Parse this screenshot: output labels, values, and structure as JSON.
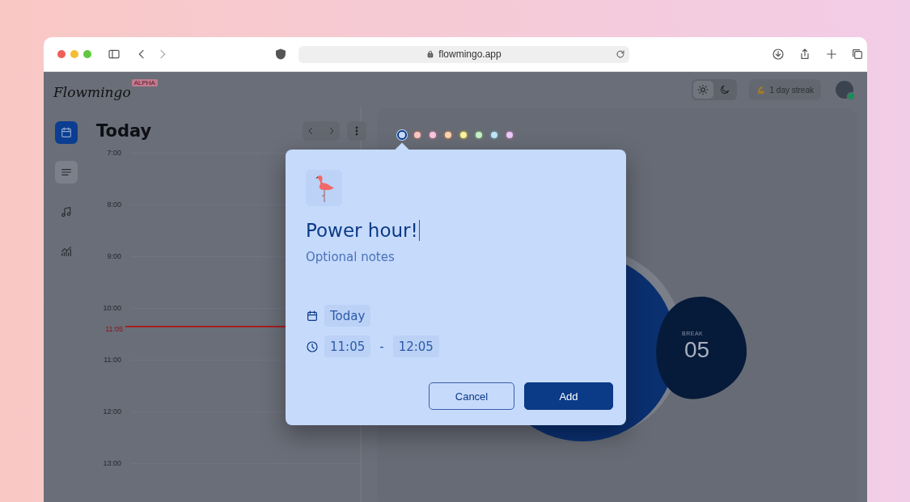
{
  "browser": {
    "url": "flowmingo.app"
  },
  "header": {
    "logo": "Flowmingo",
    "badge": "ALPHA",
    "theme_options": [
      {
        "kind": "light",
        "selected": true
      },
      {
        "kind": "dark",
        "selected": false
      }
    ],
    "streak": "1 day streak"
  },
  "sidebar": {
    "items": [
      {
        "kind": "calendar",
        "selected": true,
        "hovered": false
      },
      {
        "kind": "list",
        "selected": false,
        "hovered": true
      },
      {
        "kind": "music",
        "selected": false,
        "hovered": false
      },
      {
        "kind": "stats",
        "selected": false,
        "hovered": false
      }
    ]
  },
  "calendar": {
    "title": "Today",
    "hours": [
      "7:00",
      "8:00",
      "9:00",
      "10:00",
      "11:00",
      "12:00",
      "13:00"
    ],
    "now_label": "11:05"
  },
  "palette": [
    {
      "color": "#c6dafc",
      "selected": true
    },
    {
      "color": "#fbc6c6",
      "selected": false
    },
    {
      "color": "#f9c6e2",
      "selected": false
    },
    {
      "color": "#fcd4b4",
      "selected": false
    },
    {
      "color": "#fbf2a2",
      "selected": false
    },
    {
      "color": "#c6f0cb",
      "selected": false
    },
    {
      "color": "#c0e6f7",
      "selected": false
    },
    {
      "color": "#edc9f7",
      "selected": false
    }
  ],
  "timer": {
    "break_label": "BREAK",
    "break_value": "05"
  },
  "dialog": {
    "title": "Power hour!",
    "notes_placeholder": "Optional notes",
    "date": "Today",
    "start": "11:05",
    "separator": "-",
    "end": "12:05",
    "buttons": [
      {
        "label": "Cancel",
        "kind": "secondary"
      },
      {
        "label": "Add",
        "kind": "primary"
      }
    ]
  }
}
